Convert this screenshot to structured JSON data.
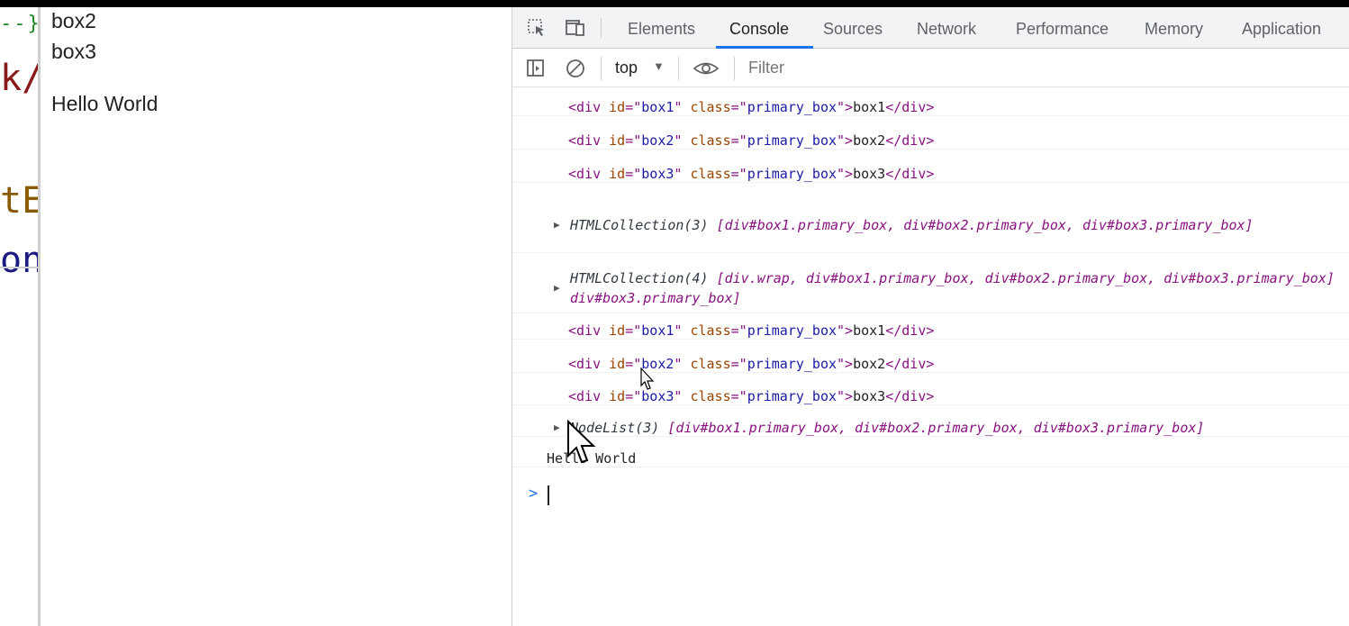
{
  "editor": {
    "frag1": "--}",
    "frag2": "k/",
    "frag3": "tE",
    "frag4": "on"
  },
  "page": {
    "lines": [
      "box2",
      "box3",
      "Hello World"
    ]
  },
  "devtools": {
    "tabs": [
      "Elements",
      "Console",
      "Sources",
      "Network",
      "Performance",
      "Memory",
      "Application"
    ],
    "active_tab": "Console",
    "context": "top",
    "filter_placeholder": "Filter",
    "colors": {
      "accent": "#1a73e8",
      "tag": "#881280",
      "attr": "#994500",
      "value": "#1a1aa6"
    }
  },
  "console": {
    "messages": [
      {
        "type": "html",
        "id": "box1",
        "cls": "primary_box",
        "text": "box1"
      },
      {
        "type": "html",
        "id": "box2",
        "cls": "primary_box",
        "text": "box2"
      },
      {
        "type": "html",
        "id": "box3",
        "cls": "primary_box",
        "text": "box3"
      },
      {
        "type": "collection",
        "label": "HTMLCollection(3)",
        "items": "[div#box1.primary_box, div#box2.primary_box, div#box3.primary_box]"
      },
      {
        "type": "collection",
        "label": "HTMLCollection(4)",
        "items": "[div.wrap, div#box1.primary_box, div#box2.primary_box, div#box3.primary_box]",
        "line2": "div#box3.primary_box]"
      },
      {
        "type": "html",
        "id": "box1",
        "cls": "primary_box",
        "text": "box1"
      },
      {
        "type": "html",
        "id": "box2",
        "cls": "primary_box",
        "text": "box2"
      },
      {
        "type": "html",
        "id": "box3",
        "cls": "primary_box",
        "text": "box3"
      },
      {
        "type": "collection",
        "label": "NodeList(3)",
        "items": "[div#box1.primary_box, div#box2.primary_box, div#box3.primary_box]"
      },
      {
        "type": "log",
        "text": "Hello World"
      }
    ],
    "prompt_symbol": ">"
  }
}
